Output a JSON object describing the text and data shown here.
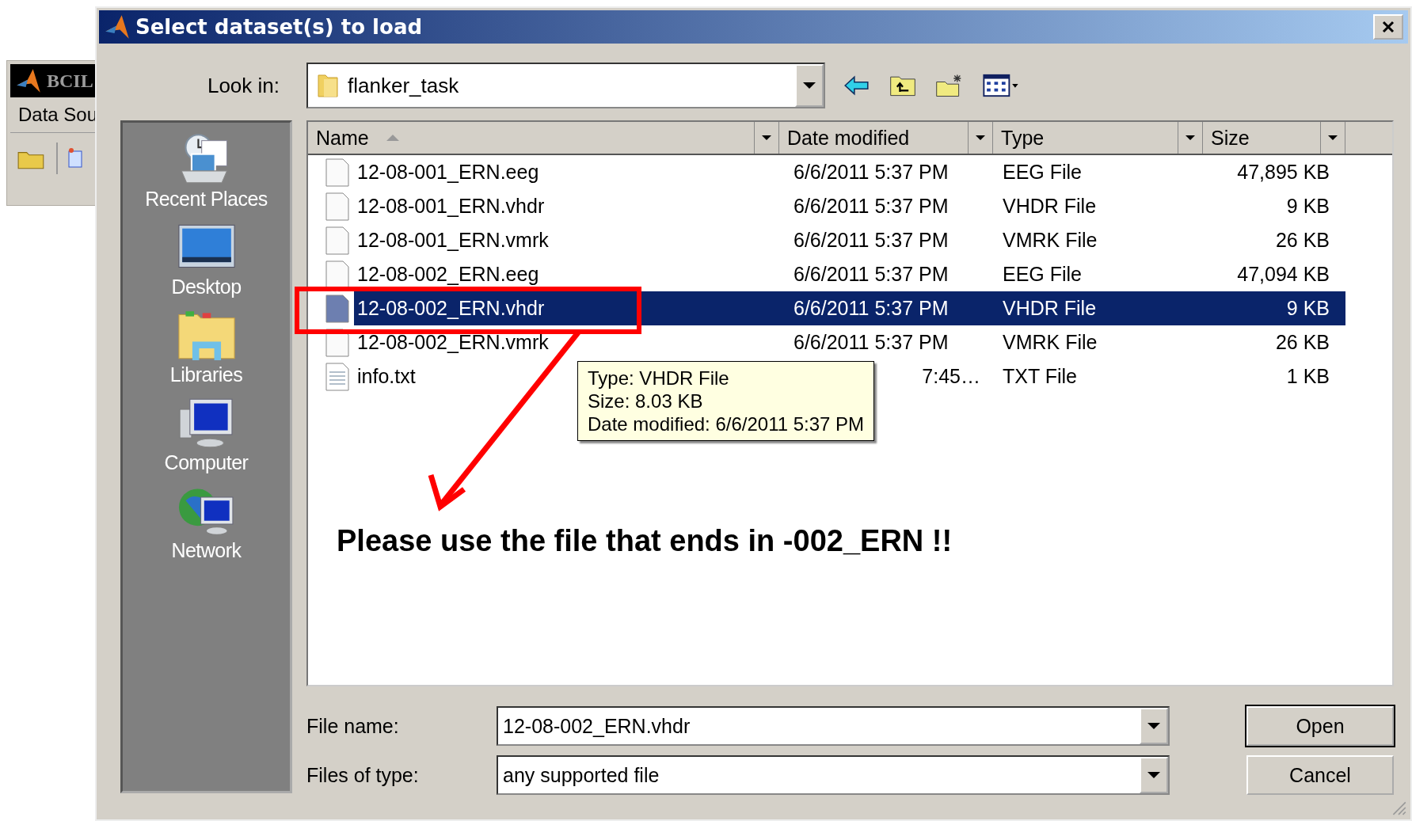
{
  "background_window": {
    "title": "BCIL",
    "menu": "Data Sou"
  },
  "dialog": {
    "title": "Select dataset(s) to load"
  },
  "look_in": {
    "label": "Look in:",
    "value": "flanker_task"
  },
  "places": [
    {
      "label": "Recent Places",
      "kind": "recent"
    },
    {
      "label": "Desktop",
      "kind": "desktop"
    },
    {
      "label": "Libraries",
      "kind": "libraries"
    },
    {
      "label": "Computer",
      "kind": "computer"
    },
    {
      "label": "Network",
      "kind": "network"
    }
  ],
  "columns": [
    {
      "label": "Name",
      "sorted": true
    },
    {
      "label": "Date modified",
      "sorted": false
    },
    {
      "label": "Type",
      "sorted": false
    },
    {
      "label": "Size",
      "sorted": false
    }
  ],
  "files": [
    {
      "name": "12-08-001_ERN.eeg",
      "date_modified": "6/6/2011 5:37 PM",
      "type": "EEG File",
      "size": "47,895 KB",
      "kind": "file",
      "selected": false
    },
    {
      "name": "12-08-001_ERN.vhdr",
      "date_modified": "6/6/2011 5:37 PM",
      "type": "VHDR File",
      "size": "9 KB",
      "kind": "file",
      "selected": false
    },
    {
      "name": "12-08-001_ERN.vmrk",
      "date_modified": "6/6/2011 5:37 PM",
      "type": "VMRK File",
      "size": "26 KB",
      "kind": "file",
      "selected": false
    },
    {
      "name": "12-08-002_ERN.eeg",
      "date_modified": "6/6/2011 5:37 PM",
      "type": "EEG File",
      "size": "47,094 KB",
      "kind": "file",
      "selected": false
    },
    {
      "name": "12-08-002_ERN.vhdr",
      "date_modified": "6/6/2011 5:37 PM",
      "type": "VHDR File",
      "size": "9 KB",
      "kind": "file",
      "selected": true
    },
    {
      "name": "12-08-002_ERN.vmrk",
      "date_modified": "6/6/2011 5:37 PM",
      "type": "VMRK File",
      "size": "26 KB",
      "kind": "file",
      "selected": false
    },
    {
      "name": "info.txt",
      "date_modified": "7:45…",
      "date_partly_hidden": true,
      "type": "TXT File",
      "size": "1 KB",
      "kind": "text",
      "selected": false
    }
  ],
  "tooltip": {
    "lines": [
      "Type: VHDR File",
      "Size: 8.03 KB",
      "Date modified: 6/6/2011 5:37 PM"
    ]
  },
  "file_name": {
    "label": "File name:",
    "value": "12-08-002_ERN.vhdr"
  },
  "file_type": {
    "label": "Files of type:",
    "value": "any supported file"
  },
  "buttons": [
    {
      "label": "Open",
      "default": true
    },
    {
      "label": "Cancel",
      "default": false
    }
  ],
  "annotation": {
    "text": "Please use the file that ends in -002_ERN !!"
  }
}
